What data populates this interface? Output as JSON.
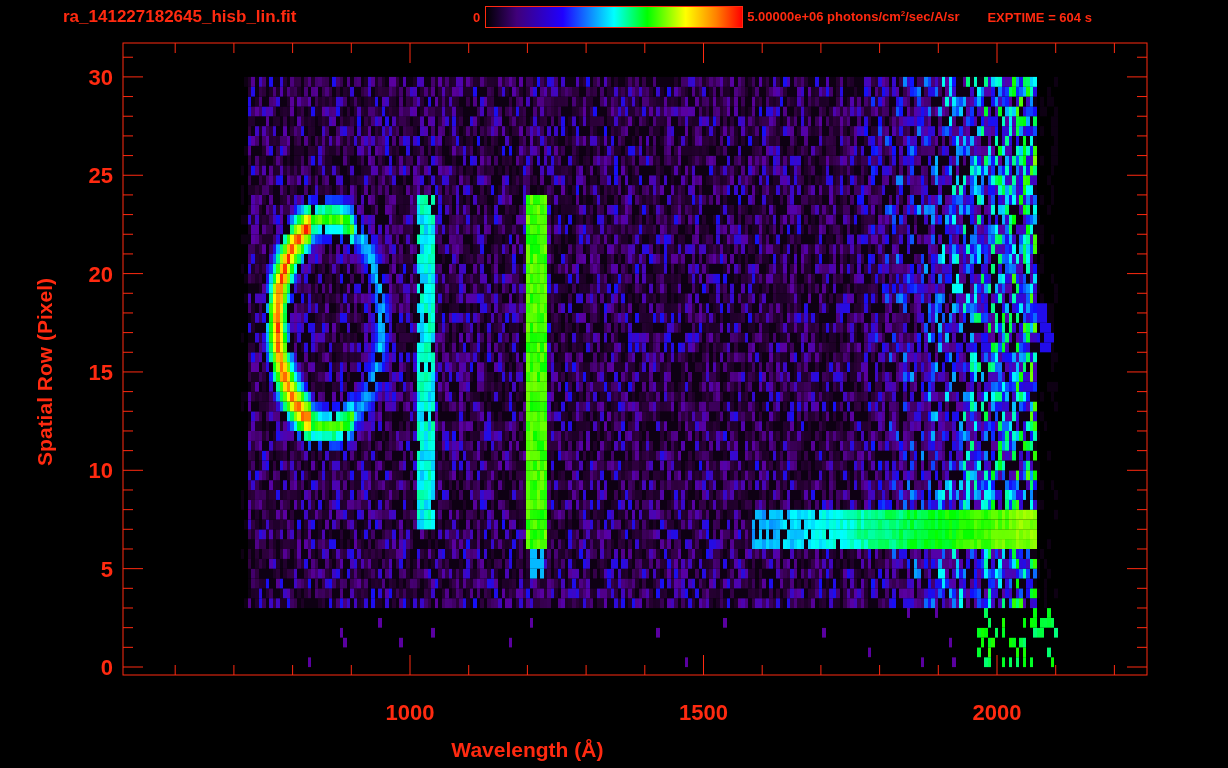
{
  "header": {
    "title": "ra_141227182645_hisb_lin.fit",
    "colorbar_min": "0",
    "colorbar_max": "5.00000e+06 photons/cm$^{2}$/sec/A/sr",
    "exptime": "EXPTIME = 604 s"
  },
  "plot": {
    "xlabel": "Wavelength (Å)",
    "ylabel": "Spatial Row (Pixel)",
    "xticks": [
      "1000",
      "1500",
      "2000"
    ],
    "yticks": [
      "30",
      "25",
      "20",
      "15",
      "10",
      "5",
      "0"
    ]
  }
}
